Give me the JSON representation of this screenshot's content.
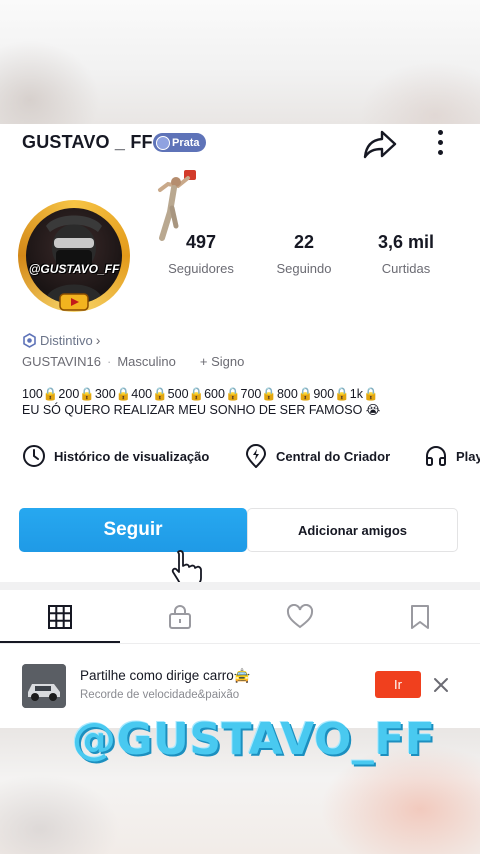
{
  "profile": {
    "username": "GUSTAVO _ FF",
    "badge_label": "Prata",
    "avatar_text": "@GUSTAVO_FF",
    "distintivo_label": "Distintivo",
    "handle": "GUSTAVIN16",
    "gender": "Masculino",
    "sign_label": "+ Signo",
    "bio_line1": "100🔒200🔒300🔒400🔒500🔒600🔒700🔒800🔒900🔒1k🔒",
    "bio_line2": "EU SÓ QUERO REALIZAR MEU SONHO DE SER FAMOSO 😭"
  },
  "stats": [
    {
      "value": "497",
      "label": "Seguidores"
    },
    {
      "value": "22",
      "label": "Seguindo"
    },
    {
      "value": "3,6 mil",
      "label": "Curtidas"
    }
  ],
  "tools": [
    {
      "label": "Histórico de visualização",
      "icon": "clock-icon"
    },
    {
      "label": "Central do Criador",
      "icon": "lightning-pin-icon"
    },
    {
      "label": "Play",
      "icon": "headphones-icon"
    }
  ],
  "actions": {
    "follow_label": "Seguir",
    "add_friends_label": "Adicionar amigos"
  },
  "tabs": [
    {
      "name": "videos",
      "icon": "grid-icon",
      "active": true
    },
    {
      "name": "private",
      "icon": "lock-icon",
      "active": false
    },
    {
      "name": "liked",
      "icon": "heart-icon",
      "active": false
    },
    {
      "name": "saved",
      "icon": "bookmark-icon",
      "active": false
    }
  ],
  "promo": {
    "title": "Partilhe como dirige carro🚖",
    "subtitle": "Recorde de velocidade&paixão",
    "cta_label": "Ir"
  },
  "watermark": "@GUSTAVO_FF",
  "colors": {
    "follow_button": "#1f9ae6",
    "badge_prata": "#5e73b8",
    "promo_cta": "#f0401e",
    "watermark": "#49c9f0"
  }
}
